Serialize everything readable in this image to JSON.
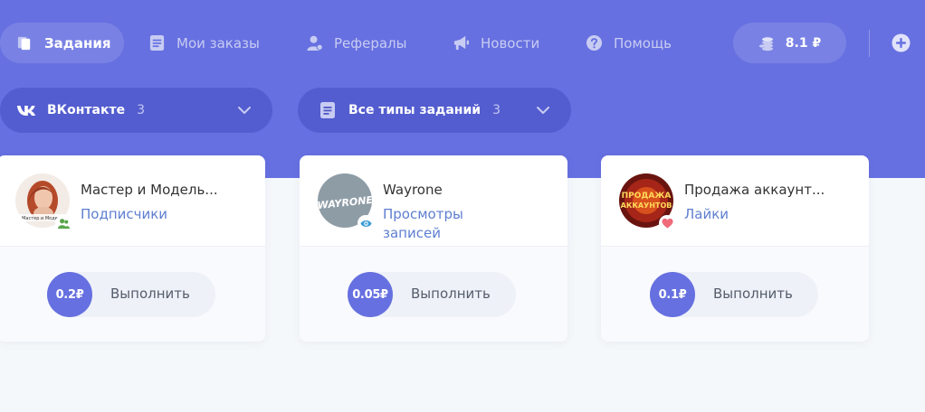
{
  "nav": {
    "items": [
      {
        "label": "Задания",
        "icon": "tasks-icon",
        "active": true
      },
      {
        "label": "Мои заказы",
        "icon": "orders-icon"
      },
      {
        "label": "Рефералы",
        "icon": "referrals-icon"
      },
      {
        "label": "Новости",
        "icon": "megaphone-icon"
      },
      {
        "label": "Помощь",
        "icon": "help-icon"
      }
    ],
    "balance": "8.1 ₽"
  },
  "filters": {
    "network": {
      "label": "ВКонтакте",
      "count": "3"
    },
    "task_type": {
      "label": "Все типы заданий",
      "count": "3"
    }
  },
  "cards": [
    {
      "title": "Мастер и Модель...",
      "type": "Подписчики",
      "price": "0.2₽",
      "action": "Выполнить",
      "avatar_text": "Мастер и Модель",
      "badge": "subscribers-icon"
    },
    {
      "title": "Wayrone",
      "type_line1": "Просмотры",
      "type_line2": "записей",
      "price": "0.05₽",
      "action": "Выполнить",
      "avatar_text": "WAYRONE",
      "badge": "eye-icon"
    },
    {
      "title": "Продажа аккаунт...",
      "type": "Лайки",
      "price": "0.1₽",
      "action": "Выполнить",
      "avatar_text_1": "ПРОДАЖА",
      "avatar_text_2": "АККАУНТОВ",
      "badge": "heart-icon"
    }
  ],
  "colors": {
    "primary": "#6670e0",
    "link": "#5e7ed0",
    "heart": "#f06a7a",
    "eye": "#3a9bd5",
    "friends": "#5aa64c"
  }
}
